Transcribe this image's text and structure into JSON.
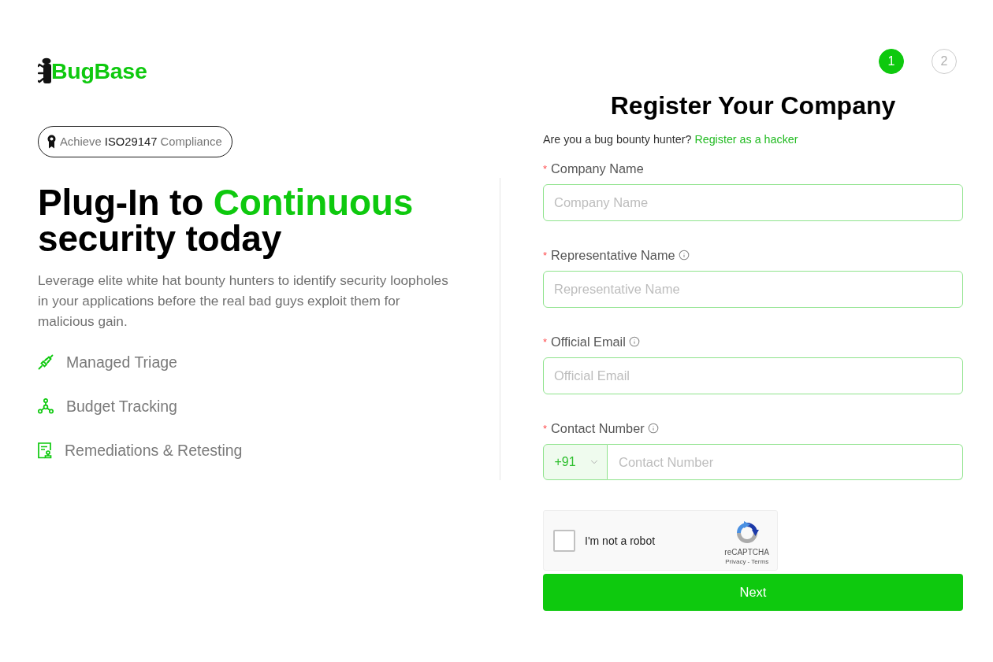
{
  "brand": {
    "name": "BugBase"
  },
  "badge": {
    "parts": [
      {
        "text": "Achieve",
        "emphasis": false
      },
      {
        "text": "ISO29147",
        "emphasis": true
      },
      {
        "text": "Compliance",
        "emphasis": false
      }
    ]
  },
  "headline": {
    "parts": [
      {
        "text": "Plug-In to ",
        "highlight": false
      },
      {
        "text": "Continuous",
        "highlight": true
      },
      {
        "text": " security today",
        "highlight": false
      }
    ]
  },
  "description": "Leverage elite white hat bounty hunters to identify security loopholes in your applications before the real bad guys exploit them for malicious gain.",
  "features": [
    {
      "label": "Managed Triage"
    },
    {
      "label": "Budget Tracking"
    },
    {
      "label": "Remediations & Retesting"
    }
  ],
  "stepper": {
    "steps": [
      {
        "label": "1",
        "selected": true
      },
      {
        "label": "2",
        "selected": false
      }
    ]
  },
  "form": {
    "title": "Register Your Company",
    "prompt": "Are you a bug bounty hunter?",
    "link": "Register as a hacker",
    "fields": [
      {
        "kind": "text",
        "required_mark": "*",
        "label": "Company Name",
        "info": false,
        "placeholder": "Company Name"
      },
      {
        "kind": "text",
        "required_mark": "*",
        "label": "Representative Name",
        "info": true,
        "placeholder": "Representative Name"
      },
      {
        "kind": "text",
        "required_mark": "*",
        "label": "Official Email",
        "info": true,
        "placeholder": "Official Email"
      },
      {
        "kind": "phone",
        "required_mark": "*",
        "label": "Contact Number",
        "info": true,
        "country_code": "+91",
        "placeholder": "Contact Number"
      }
    ],
    "captcha": {
      "label": "I'm not a robot",
      "checked": false,
      "brand": "reCAPTCHA",
      "links": "Privacy - Terms"
    },
    "submit": "Next"
  }
}
